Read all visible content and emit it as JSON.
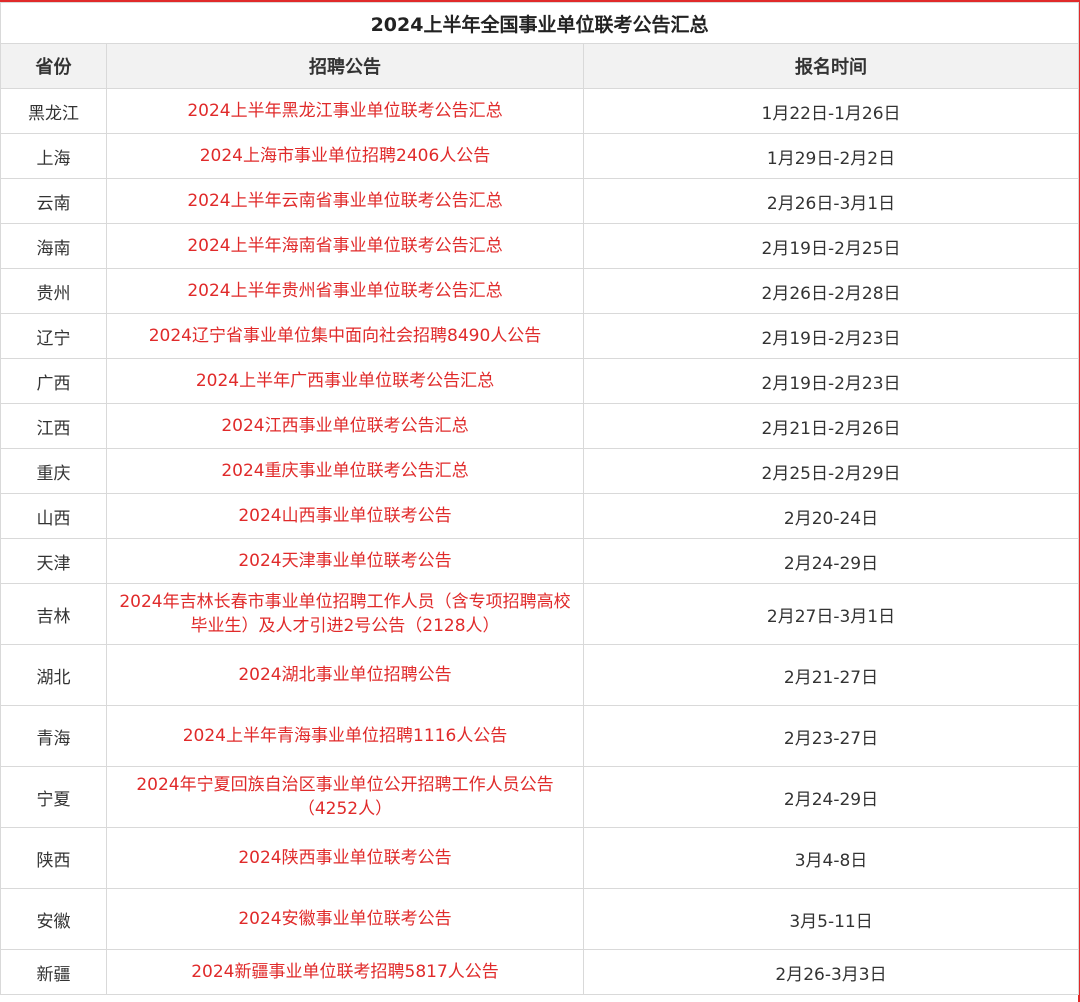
{
  "title": "2024上半年全国事业单位联考公告汇总",
  "colors": {
    "accent_red": "#e02a2a",
    "header_bg": "#f2f2f2",
    "grid_line": "#d9d9d9"
  },
  "columns": {
    "province": "省份",
    "notice": "招聘公告",
    "date": "报名时间"
  },
  "rows": [
    {
      "province": "黑龙江",
      "notice": "2024上半年黑龙江事业单位联考公告汇总",
      "date": "1月22日-1月26日"
    },
    {
      "province": "上海",
      "notice": "2024上海市事业单位招聘2406人公告",
      "date": "1月29日-2月2日"
    },
    {
      "province": "云南",
      "notice": "2024上半年云南省事业单位联考公告汇总",
      "date": "2月26日-3月1日"
    },
    {
      "province": "海南",
      "notice": "2024上半年海南省事业单位联考公告汇总",
      "date": "2月19日-2月25日"
    },
    {
      "province": "贵州",
      "notice": "2024上半年贵州省事业单位联考公告汇总",
      "date": "2月26日-2月28日"
    },
    {
      "province": "辽宁",
      "notice": "2024辽宁省事业单位集中面向社会招聘8490人公告",
      "date": "2月19日-2月23日"
    },
    {
      "province": "广西",
      "notice": "2024上半年广西事业单位联考公告汇总",
      "date": "2月19日-2月23日"
    },
    {
      "province": "江西",
      "notice": "2024江西事业单位联考公告汇总",
      "date": "2月21日-2月26日"
    },
    {
      "province": "重庆",
      "notice": "2024重庆事业单位联考公告汇总",
      "date": "2月25日-2月29日"
    },
    {
      "province": "山西",
      "notice": "2024山西事业单位联考公告",
      "date": "2月20-24日"
    },
    {
      "province": "天津",
      "notice": "2024天津事业单位联考公告",
      "date": "2月24-29日"
    },
    {
      "province": "吉林",
      "notice": "2024年吉林长春市事业单位招聘工作人员（含专项招聘高校毕业生）及人才引进2号公告（2128人）",
      "date": "2月27日-3月1日"
    },
    {
      "province": "湖北",
      "notice": "2024湖北事业单位招聘公告",
      "date": "2月21-27日"
    },
    {
      "province": "青海",
      "notice": "2024上半年青海事业单位招聘1116人公告",
      "date": "2月23-27日"
    },
    {
      "province": "宁夏",
      "notice": "2024年宁夏回族自治区事业单位公开招聘工作人员公告（4252人）",
      "date": "2月24-29日"
    },
    {
      "province": "陕西",
      "notice": "2024陕西事业单位联考公告",
      "date": "3月4-8日"
    },
    {
      "province": "安徽",
      "notice": "2024安徽事业单位联考公告",
      "date": "3月5-11日"
    },
    {
      "province": "新疆",
      "notice": "2024新疆事业单位联考招聘5817人公告",
      "date": "2月26-3月3日"
    }
  ]
}
